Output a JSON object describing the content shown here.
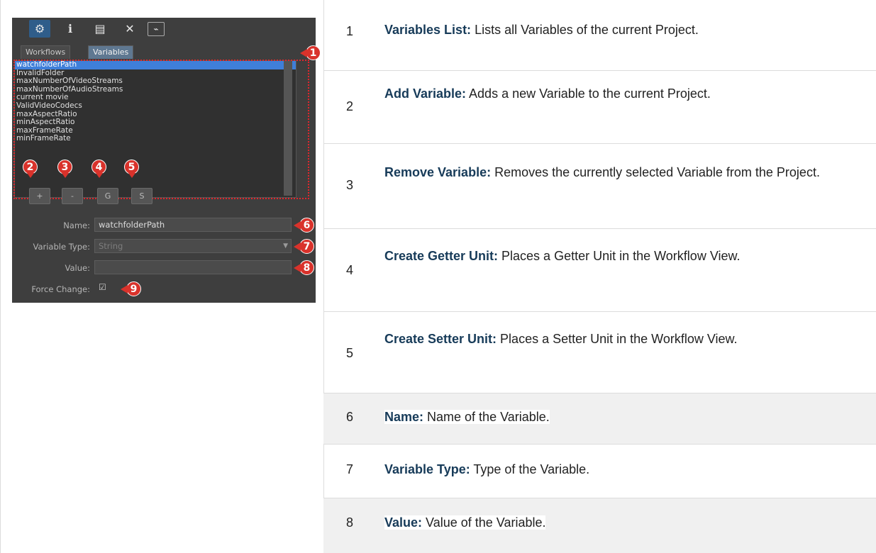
{
  "toolbar": {
    "icons": [
      "gears-icon",
      "info-icon",
      "stack-icon",
      "expand-icon",
      "monitor-icon"
    ]
  },
  "tabs": [
    {
      "label": "Workflows",
      "active": false
    },
    {
      "label": "Variables",
      "active": true
    }
  ],
  "variables_list": [
    "watchfolderPath",
    "InvalidFolder",
    "maxNumberOfVideoStreams",
    "maxNumberOfAudioStreams",
    "current movie",
    "ValidVideoCodecs",
    "maxAspectRatio",
    "minAspectRatio",
    "maxFrameRate",
    "minFrameRate"
  ],
  "buttons": {
    "add": "+",
    "remove": "-",
    "getter": "G",
    "setter": "S"
  },
  "form": {
    "name_label": "Name:",
    "name_value": "watchfolderPath",
    "type_label": "Variable Type:",
    "type_value": "String",
    "value_label": "Value:",
    "value_value": "",
    "force_label": "Force Change:",
    "force_checked": "☑"
  },
  "callouts": [
    "1",
    "2",
    "3",
    "4",
    "5",
    "6",
    "7",
    "8",
    "9"
  ],
  "table": [
    {
      "num": "1",
      "term": "Variables List:",
      "desc": " Lists all Variables of the current Project."
    },
    {
      "num": "2",
      "term": "Add Variable:",
      "desc": " Adds a new Variable to the current Project."
    },
    {
      "num": "3",
      "term": "Remove Variable:",
      "desc": " Removes the currently selected Variable from the Project."
    },
    {
      "num": "4",
      "term": "Create Getter Unit:",
      "desc": " Places a Getter Unit in the Workflow View."
    },
    {
      "num": "5",
      "term": "Create Setter Unit:",
      "desc": " Places a Setter Unit in the Workflow View."
    },
    {
      "num": "6",
      "term": "Name:",
      "desc": " Name of the Variable."
    },
    {
      "num": "7",
      "term": "Variable Type:",
      "desc": " Type of the Variable."
    },
    {
      "num": "8",
      "term": "Value:",
      "desc": " Value of the Variable."
    }
  ],
  "colors": {
    "callout": "#d9322b",
    "selection": "#3f7fd9",
    "term": "#173b59"
  }
}
